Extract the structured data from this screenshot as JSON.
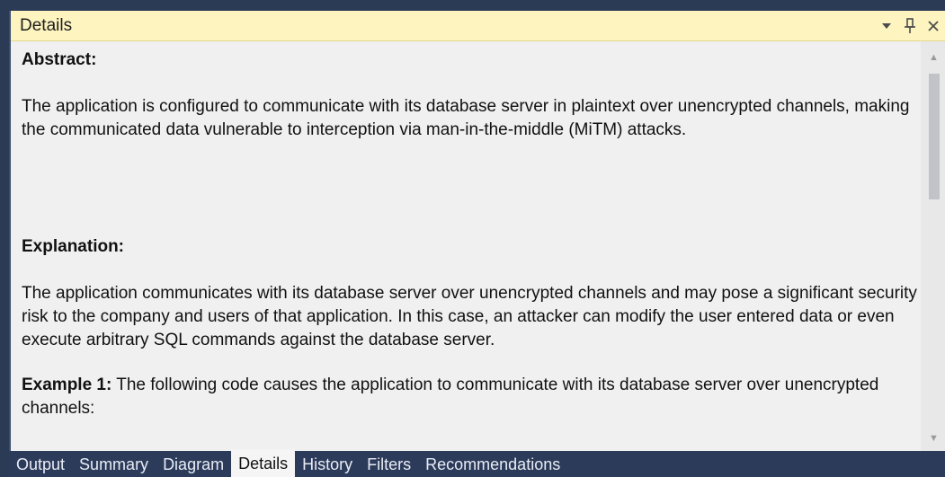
{
  "window": {
    "title": "Details",
    "menu_icon": "dropdown-arrow-icon",
    "pin_icon": "pin-icon",
    "close_icon": "close-icon"
  },
  "details": {
    "abstract_heading": "Abstract:",
    "abstract_text": "The application is configured to communicate with its database server in plaintext over unencrypted channels, making the communicated data vulnerable to interception via man-in-the-middle (MiTM) attacks.",
    "explanation_heading": "Explanation:",
    "explanation_text": "The application communicates with its database server over unencrypted channels and may pose a significant security risk to the company and users of that application. In this case, an attacker can modify the user entered data or even execute arbitrary SQL commands against the database server.",
    "example_label": "Example 1:",
    "example_text": " The following code causes the application to communicate with its database server over unencrypted channels:"
  },
  "tabs": [
    {
      "label": "Output"
    },
    {
      "label": "Summary"
    },
    {
      "label": "Diagram"
    },
    {
      "label": "Details"
    },
    {
      "label": "History"
    },
    {
      "label": "Filters"
    },
    {
      "label": "Recommendations"
    }
  ],
  "active_tab": "Details",
  "colors": {
    "titlebar_bg": "#fdf4bf",
    "tabbar_bg": "#2d3b5b",
    "content_bg": "#f0f0f0"
  }
}
